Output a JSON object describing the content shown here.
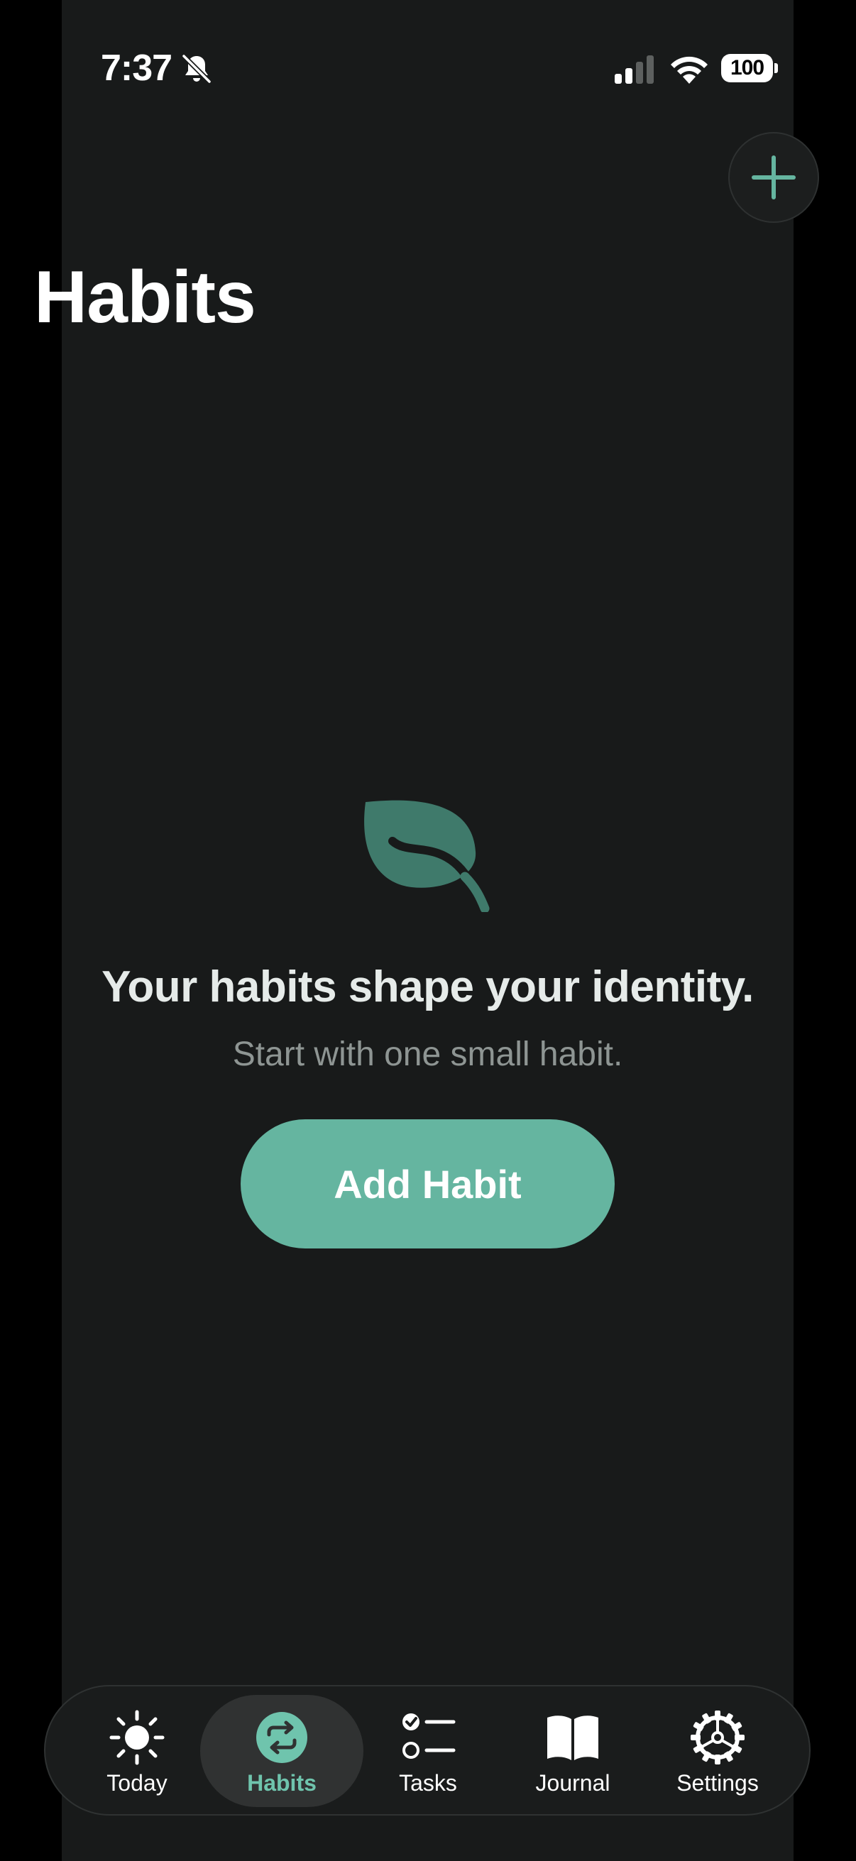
{
  "status_bar": {
    "time": "7:37",
    "battery": "100"
  },
  "header": {
    "title": "Habits",
    "add_icon": "plus-icon"
  },
  "empty_state": {
    "icon": "leaf-icon",
    "heading": "Your habits shape your identity.",
    "subheading": "Start with one small habit.",
    "button_label": "Add Habit"
  },
  "tabs": [
    {
      "label": "Today",
      "icon": "sun-icon",
      "active": false
    },
    {
      "label": "Habits",
      "icon": "repeat-icon",
      "active": true
    },
    {
      "label": "Tasks",
      "icon": "checklist-icon",
      "active": false
    },
    {
      "label": "Journal",
      "icon": "book-icon",
      "active": false
    },
    {
      "label": "Settings",
      "icon": "gear-icon",
      "active": false
    }
  ],
  "colors": {
    "accent": "#65b5a0",
    "accent_light": "#6fc4ad",
    "background": "#181a1a"
  }
}
